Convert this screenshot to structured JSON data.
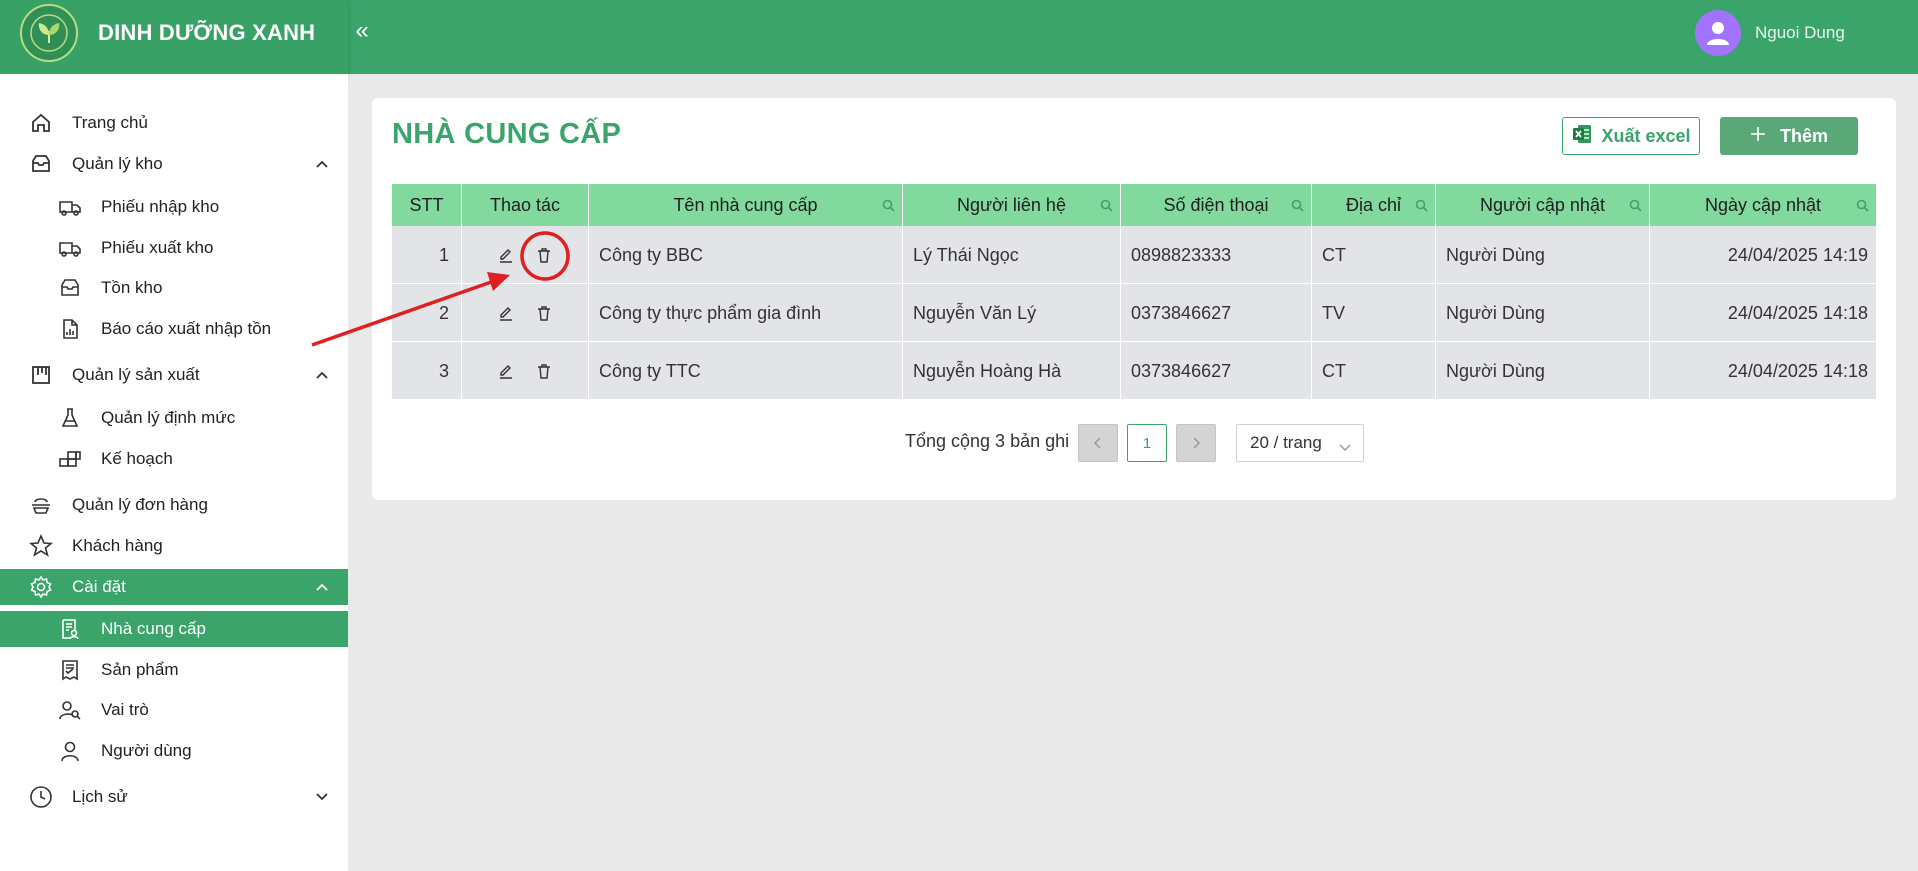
{
  "app": {
    "brand_name": "DINH DƯỠNG XANH",
    "user_name": "Nguoi Dung"
  },
  "sidebar": {
    "items": [
      {
        "label": "Trang chủ",
        "icon": "home-icon"
      },
      {
        "label": "Quản lý kho",
        "icon": "inbox-icon",
        "expanded": true
      },
      {
        "label": "Phiếu nhập kho",
        "icon": "truck-in-icon"
      },
      {
        "label": "Phiếu xuất kho",
        "icon": "truck-out-icon"
      },
      {
        "label": "Tồn kho",
        "icon": "inbox-icon"
      },
      {
        "label": "Báo cáo xuất nhập tồn",
        "icon": "report-icon"
      },
      {
        "label": "Quản lý sản xuất",
        "icon": "factory-icon",
        "expanded": true
      },
      {
        "label": "Quản lý định mức",
        "icon": "flask-icon"
      },
      {
        "label": "Kế hoạch",
        "icon": "blocks-icon"
      },
      {
        "label": "Quản lý đơn hàng",
        "icon": "order-icon"
      },
      {
        "label": "Khách hàng",
        "icon": "star-icon"
      },
      {
        "label": "Cài đặt",
        "icon": "gear-icon",
        "expanded": true,
        "active": true
      },
      {
        "label": "Nhà cung cấp",
        "icon": "supplier-icon",
        "active": true
      },
      {
        "label": "Sản phẩm",
        "icon": "product-icon"
      },
      {
        "label": "Vai trò",
        "icon": "role-icon"
      },
      {
        "label": "Người dùng",
        "icon": "user-icon"
      },
      {
        "label": "Lịch sử",
        "icon": "clock-icon",
        "expanded": false
      }
    ]
  },
  "main": {
    "title": "NHÀ CUNG CẤP",
    "export_label": "Xuất excel",
    "add_label": "Thêm",
    "table": {
      "columns": [
        "STT",
        "Thao tác",
        "Tên nhà cung cấp",
        "Người liên hệ",
        "Số điện thoại",
        "Địa chỉ",
        "Người cập nhật",
        "Ngày cập nhật"
      ],
      "rows": [
        {
          "stt": "1",
          "name": "Công ty BBC",
          "contact": "Lý Thái Ngọc",
          "phone": "0898823333",
          "address": "CT",
          "updated_by": "Người Dùng",
          "updated_at": "24/04/2025 14:19"
        },
        {
          "stt": "2",
          "name": "Công ty thực phẩm gia đình",
          "contact": "Nguyễn Văn Lý",
          "phone": "0373846627",
          "address": "TV",
          "updated_by": "Người Dùng",
          "updated_at": "24/04/2025 14:18"
        },
        {
          "stt": "3",
          "name": "Công ty TTC",
          "contact": "Nguyễn Hoàng Hà",
          "phone": "0373846627",
          "address": "CT",
          "updated_by": "Người Dùng",
          "updated_at": "24/04/2025 14:18"
        }
      ]
    },
    "pagination": {
      "total_text": "Tổng cộng 3 bản ghi",
      "current_page": "1",
      "page_size": "20 / trang"
    }
  },
  "colors": {
    "primary": "#3aa46b",
    "table_header": "#82d99d",
    "row_bg": "#e3e4e8",
    "annotation": "#e02020"
  }
}
